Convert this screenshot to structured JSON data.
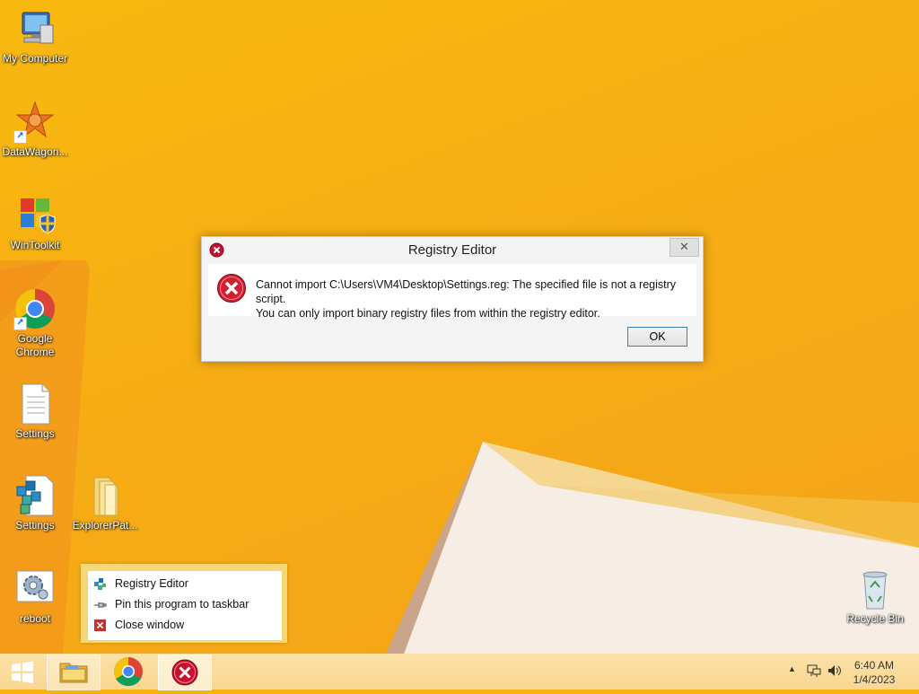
{
  "desktop": {
    "icons": [
      {
        "label": "My Computer"
      },
      {
        "label": "DataWagon..."
      },
      {
        "label": "WinToolkit"
      },
      {
        "label": "Google\nChrome"
      },
      {
        "label": "Settings"
      },
      {
        "label": "Settings"
      },
      {
        "label": "ExplorerPat..."
      },
      {
        "label": "reboot"
      },
      {
        "label": "Recycle Bin"
      }
    ]
  },
  "dialog": {
    "title": "Registry Editor",
    "message_line1": "Cannot import C:\\Users\\VM4\\Desktop\\Settings.reg: The specified file is not a registry script.",
    "message_line2": "You can only import binary registry files from within the registry editor.",
    "ok_label": "OK",
    "close_glyph": "✕"
  },
  "jumplist": {
    "items": [
      {
        "label": "Registry Editor",
        "icon": "registry-editor-icon"
      },
      {
        "label": "Pin this program to taskbar",
        "icon": "pin-icon"
      },
      {
        "label": "Close window",
        "icon": "close-window-icon"
      }
    ]
  },
  "taskbar": {
    "clock_time": "6:40 AM",
    "clock_date": "1/4/2023",
    "tray_arrow": "▲"
  },
  "colors": {
    "wallpaper": "#f7b212",
    "taskbar": "#f9d791",
    "error_red": "#c8102e",
    "ok_border": "#3c7fb1"
  }
}
